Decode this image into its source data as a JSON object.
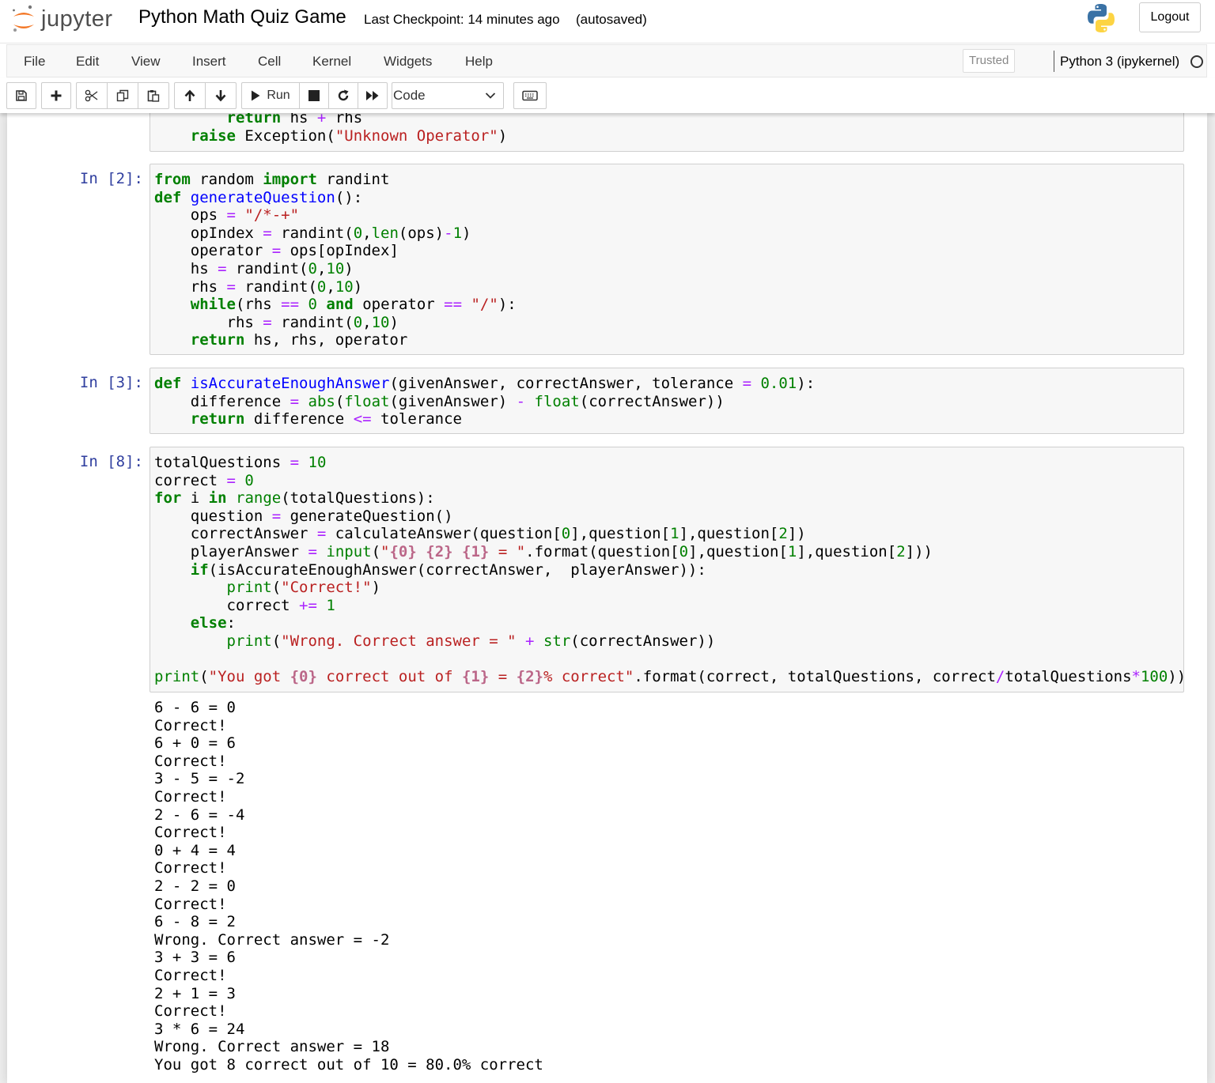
{
  "header": {
    "logo_text": "jupyter",
    "notebook_title": "Python Math Quiz Game",
    "checkpoint": "Last Checkpoint: 14 minutes ago",
    "autosave_status": "(autosaved)",
    "logout_label": "Logout"
  },
  "menubar": {
    "items": [
      "File",
      "Edit",
      "View",
      "Insert",
      "Cell",
      "Kernel",
      "Widgets",
      "Help"
    ],
    "trusted_label": "Trusted",
    "kernel_name": "Python 3 (ipykernel)"
  },
  "toolbar": {
    "run_label": "Run",
    "cell_type": "Code"
  },
  "cells": [
    {
      "prompt": "",
      "lines": [
        [
          [
            "",
            "        "
          ],
          [
            "kw",
            "return"
          ],
          [
            "",
            " hs "
          ],
          [
            "op",
            "+"
          ],
          [
            "",
            " rhs"
          ]
        ],
        [
          [
            "",
            "    "
          ],
          [
            "kw",
            "raise"
          ],
          [
            "",
            " Exception("
          ],
          [
            "st",
            "\"Unknown Operator\""
          ],
          [
            "",
            ")"
          ]
        ]
      ]
    },
    {
      "prompt": "In [2]:",
      "lines": [
        [
          [
            "kw",
            "from"
          ],
          [
            "",
            " random "
          ],
          [
            "kw",
            "import"
          ],
          [
            "",
            " randint"
          ]
        ],
        [
          [
            "kw",
            "def"
          ],
          [
            "",
            " "
          ],
          [
            "fn",
            "generateQuestion"
          ],
          [
            "",
            "():"
          ]
        ],
        [
          [
            "",
            "    ops "
          ],
          [
            "op",
            "="
          ],
          [
            "",
            " "
          ],
          [
            "st",
            "\"/*-+\""
          ]
        ],
        [
          [
            "",
            "    opIndex "
          ],
          [
            "op",
            "="
          ],
          [
            "",
            " randint("
          ],
          [
            "nu",
            "0"
          ],
          [
            "",
            ","
          ],
          [
            "bi",
            "len"
          ],
          [
            "",
            "(ops)"
          ],
          [
            "op",
            "-"
          ],
          [
            "nu",
            "1"
          ],
          [
            "",
            ")"
          ]
        ],
        [
          [
            "",
            "    operator "
          ],
          [
            "op",
            "="
          ],
          [
            "",
            " ops[opIndex]"
          ]
        ],
        [
          [
            "",
            "    hs "
          ],
          [
            "op",
            "="
          ],
          [
            "",
            " randint("
          ],
          [
            "nu",
            "0"
          ],
          [
            "",
            ","
          ],
          [
            "nu",
            "10"
          ],
          [
            "",
            ")"
          ]
        ],
        [
          [
            "",
            "    rhs "
          ],
          [
            "op",
            "="
          ],
          [
            "",
            " randint("
          ],
          [
            "nu",
            "0"
          ],
          [
            "",
            ","
          ],
          [
            "nu",
            "10"
          ],
          [
            "",
            ")"
          ]
        ],
        [
          [
            "",
            "    "
          ],
          [
            "kw",
            "while"
          ],
          [
            "",
            "(rhs "
          ],
          [
            "op",
            "=="
          ],
          [
            "",
            " "
          ],
          [
            "nu",
            "0"
          ],
          [
            "",
            " "
          ],
          [
            "kw",
            "and"
          ],
          [
            "",
            " operator "
          ],
          [
            "op",
            "=="
          ],
          [
            "",
            " "
          ],
          [
            "st",
            "\"/\""
          ],
          [
            "",
            "):"
          ]
        ],
        [
          [
            "",
            "        rhs "
          ],
          [
            "op",
            "="
          ],
          [
            "",
            " randint("
          ],
          [
            "nu",
            "0"
          ],
          [
            "",
            ","
          ],
          [
            "nu",
            "10"
          ],
          [
            "",
            ")"
          ]
        ],
        [
          [
            "",
            "    "
          ],
          [
            "kw",
            "return"
          ],
          [
            "",
            " hs, rhs, operator"
          ]
        ]
      ]
    },
    {
      "prompt": "In [3]:",
      "lines": [
        [
          [
            "kw",
            "def"
          ],
          [
            "",
            " "
          ],
          [
            "fn",
            "isAccurateEnoughAnswer"
          ],
          [
            "",
            "(givenAnswer, correctAnswer, tolerance "
          ],
          [
            "op",
            "="
          ],
          [
            "",
            " "
          ],
          [
            "nu",
            "0.01"
          ],
          [
            "",
            "):"
          ]
        ],
        [
          [
            "",
            "    difference "
          ],
          [
            "op",
            "="
          ],
          [
            "",
            " "
          ],
          [
            "bi",
            "abs"
          ],
          [
            "",
            "("
          ],
          [
            "bi",
            "float"
          ],
          [
            "",
            "(givenAnswer) "
          ],
          [
            "op",
            "-"
          ],
          [
            "",
            " "
          ],
          [
            "bi",
            "float"
          ],
          [
            "",
            "(correctAnswer))"
          ]
        ],
        [
          [
            "",
            "    "
          ],
          [
            "kw",
            "return"
          ],
          [
            "",
            " difference "
          ],
          [
            "op",
            "<="
          ],
          [
            "",
            " tolerance"
          ]
        ]
      ]
    },
    {
      "prompt": "In [8]:",
      "lines": [
        [
          [
            "",
            "totalQuestions "
          ],
          [
            "op",
            "="
          ],
          [
            "",
            " "
          ],
          [
            "nu",
            "10"
          ]
        ],
        [
          [
            "",
            "correct "
          ],
          [
            "op",
            "="
          ],
          [
            "",
            " "
          ],
          [
            "nu",
            "0"
          ]
        ],
        [
          [
            "kw",
            "for"
          ],
          [
            "",
            " i "
          ],
          [
            "kw",
            "in"
          ],
          [
            "",
            " "
          ],
          [
            "bi",
            "range"
          ],
          [
            "",
            "(totalQuestions):"
          ]
        ],
        [
          [
            "",
            "    question "
          ],
          [
            "op",
            "="
          ],
          [
            "",
            " generateQuestion()"
          ]
        ],
        [
          [
            "",
            "    correctAnswer "
          ],
          [
            "op",
            "="
          ],
          [
            "",
            " calculateAnswer(question["
          ],
          [
            "nu",
            "0"
          ],
          [
            "",
            "],question["
          ],
          [
            "nu",
            "1"
          ],
          [
            "",
            "],question["
          ],
          [
            "nu",
            "2"
          ],
          [
            "",
            "])"
          ]
        ],
        [
          [
            "",
            "    playerAnswer "
          ],
          [
            "op",
            "="
          ],
          [
            "",
            " "
          ],
          [
            "bi",
            "input"
          ],
          [
            "",
            "("
          ],
          [
            "st",
            "\""
          ],
          [
            "sp",
            "{0}"
          ],
          [
            "st",
            " "
          ],
          [
            "sp",
            "{2}"
          ],
          [
            "st",
            " "
          ],
          [
            "sp",
            "{1}"
          ],
          [
            "st",
            " = \""
          ],
          [
            "",
            ".format(question["
          ],
          [
            "nu",
            "0"
          ],
          [
            "",
            "],question["
          ],
          [
            "nu",
            "1"
          ],
          [
            "",
            "],question["
          ],
          [
            "nu",
            "2"
          ],
          [
            "",
            "]))"
          ]
        ],
        [
          [
            "",
            "    "
          ],
          [
            "kw",
            "if"
          ],
          [
            "",
            "(isAccurateEnoughAnswer(correctAnswer,  playerAnswer)):"
          ]
        ],
        [
          [
            "",
            "        "
          ],
          [
            "bi",
            "print"
          ],
          [
            "",
            "("
          ],
          [
            "st",
            "\"Correct!\""
          ],
          [
            "",
            ")"
          ]
        ],
        [
          [
            "",
            "        correct "
          ],
          [
            "op",
            "+="
          ],
          [
            "",
            " "
          ],
          [
            "nu",
            "1"
          ]
        ],
        [
          [
            "",
            "    "
          ],
          [
            "kw",
            "else"
          ],
          [
            "",
            ":"
          ]
        ],
        [
          [
            "",
            "        "
          ],
          [
            "bi",
            "print"
          ],
          [
            "",
            "("
          ],
          [
            "st",
            "\"Wrong. Correct answer = \""
          ],
          [
            "",
            " "
          ],
          [
            "op",
            "+"
          ],
          [
            "",
            " "
          ],
          [
            "bi",
            "str"
          ],
          [
            "",
            "(correctAnswer))"
          ]
        ],
        [
          [
            "",
            ""
          ]
        ],
        [
          [
            "bi",
            "print"
          ],
          [
            "",
            "("
          ],
          [
            "st",
            "\"You got "
          ],
          [
            "sp",
            "{0}"
          ],
          [
            "st",
            " correct out of "
          ],
          [
            "sp",
            "{1}"
          ],
          [
            "st",
            " = "
          ],
          [
            "sp",
            "{2}"
          ],
          [
            "st",
            "% correct\""
          ],
          [
            "",
            ".format(correct, totalQuestions, correct"
          ],
          [
            "op",
            "/"
          ],
          [
            "",
            "totalQuestions"
          ],
          [
            "op",
            "*"
          ],
          [
            "nu",
            "100"
          ],
          [
            "",
            "))"
          ]
        ]
      ],
      "output": [
        "6 - 6 = 0",
        "Correct!",
        "6 + 0 = 6",
        "Correct!",
        "3 - 5 = -2",
        "Correct!",
        "2 - 6 = -4",
        "Correct!",
        "0 + 4 = 4",
        "Correct!",
        "2 - 2 = 0",
        "Correct!",
        "6 - 8 = 2",
        "Wrong. Correct answer = -2",
        "3 + 3 = 6",
        "Correct!",
        "2 + 1 = 3",
        "Correct!",
        "3 * 6 = 24",
        "Wrong. Correct answer = 18",
        "You got 8 correct out of 10 = 80.0% correct"
      ]
    }
  ]
}
